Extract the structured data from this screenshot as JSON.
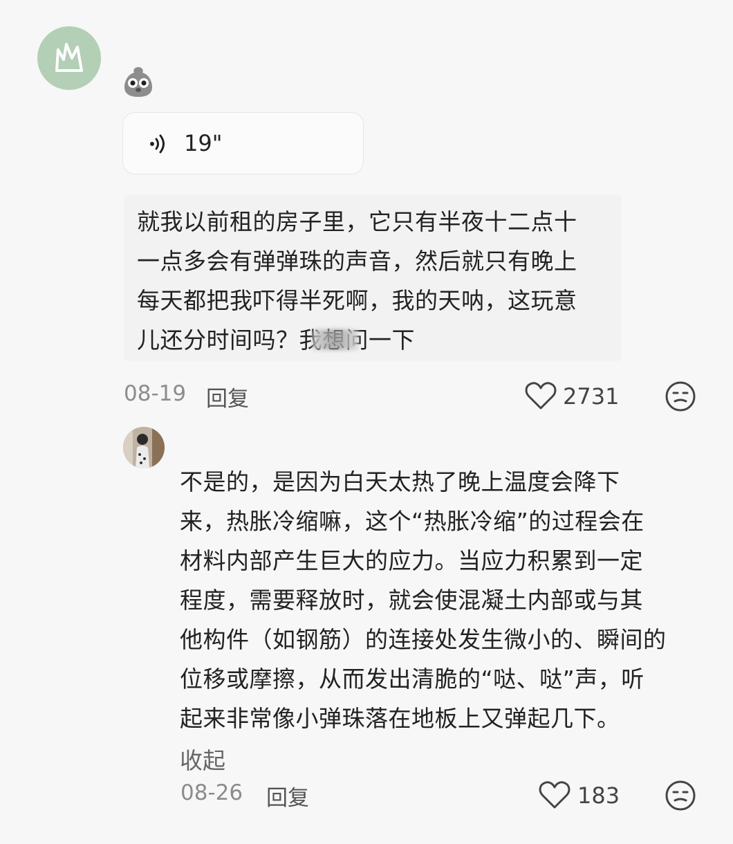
{
  "comment": {
    "sticker": "ghost-face-sticker",
    "voice": {
      "icon": "sound-wave-icon",
      "duration": "19\""
    },
    "transcript": "就我以前租的房子里，它只有半夜十二点十\n一点多会有弹弹珠的声音，然后就只有晚上\n每天都把我吓得半死啊，我的天呐，这玩意\n儿还分时间吗？我想问一下",
    "date": "08-19",
    "reply_label": "回复",
    "likes": "2731"
  },
  "reply": {
    "text": "不是的，是因为白天太热了晚上温度会降下\n来，热胀冷缩嘛，这个“热胀冷缩”的过程会在\n材料内部产生巨大的应力。当应力积累到一定\n程度，需要释放时，就会使混凝土内部或与其\n他构件（如钢筋）的连接处发生微小的、瞬间的\n位移或摩擦，从而发出清脆的“哒、哒”声，听\n起来非常像小弹珠落在地板上又弹起几下。",
    "collapse_label": "收起",
    "date": "08-26",
    "reply_label": "回复",
    "likes": "183"
  },
  "colors": {
    "avatar_bg": "#b3cfb6",
    "background": "#f7f7f7"
  }
}
